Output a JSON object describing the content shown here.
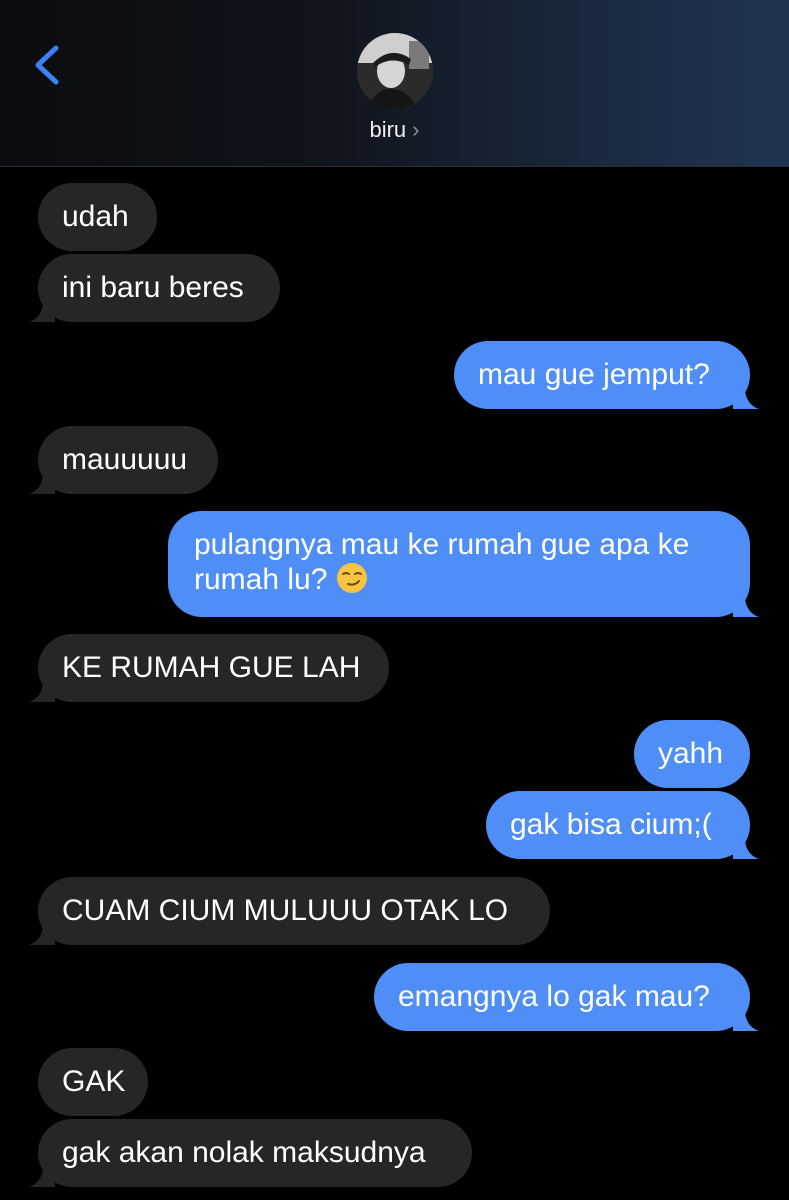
{
  "header": {
    "back_icon": "chevron-left-icon",
    "contact_name": "biru",
    "contact_chevron": "›",
    "accent_color": "#3b82f6"
  },
  "messages": [
    {
      "dir": "received",
      "text": "udah"
    },
    {
      "dir": "received",
      "text": "ini baru beres"
    },
    {
      "dir": "sent",
      "text": "mau gue jemput?"
    },
    {
      "dir": "received",
      "text": "mauuuuu"
    },
    {
      "dir": "sent",
      "text": "pulangnya mau ke rumah gue apa ke rumah lu?",
      "emoji": "smirking-face-icon"
    },
    {
      "dir": "received",
      "text": "KE RUMAH GUE LAH"
    },
    {
      "dir": "sent",
      "text": "yahh"
    },
    {
      "dir": "sent",
      "text": "gak bisa cium;("
    },
    {
      "dir": "received",
      "text": "CUAM CIUM MULUUU OTAK LO"
    },
    {
      "dir": "sent",
      "text": "emangnya lo gak mau?"
    },
    {
      "dir": "received",
      "text": "GAK"
    },
    {
      "dir": "received",
      "text": "gak akan nolak maksudnya"
    }
  ],
  "colors": {
    "sent_bubble": "#4f8ef7",
    "received_bubble": "#262628",
    "background": "#000000"
  }
}
